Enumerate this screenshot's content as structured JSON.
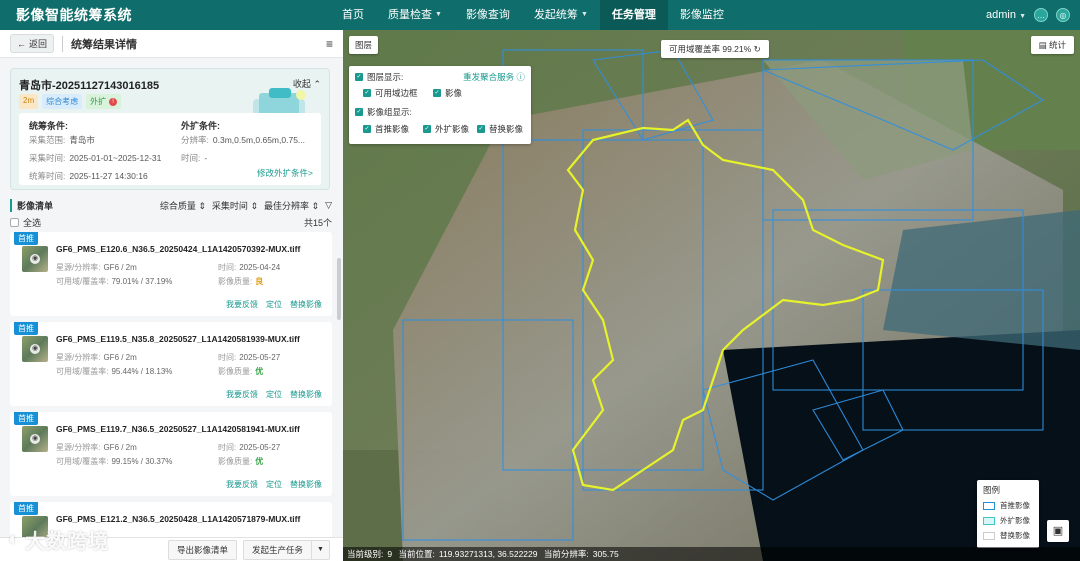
{
  "app": {
    "title": "影像智能统筹系统"
  },
  "nav": [
    {
      "label": "首页",
      "caret": false,
      "active": false
    },
    {
      "label": "质量检查",
      "caret": true,
      "active": false
    },
    {
      "label": "影像查询",
      "caret": false,
      "active": false
    },
    {
      "label": "发起统筹",
      "caret": true,
      "active": false
    },
    {
      "label": "任务管理",
      "caret": false,
      "active": true
    },
    {
      "label": "影像监控",
      "caret": false,
      "active": false
    }
  ],
  "user": {
    "name": "admin"
  },
  "panel": {
    "back_label": "返回",
    "title": "统筹结果详情",
    "task": {
      "name": "青岛市-20251127143016185",
      "collapse_label": "收起",
      "tags": [
        "2m",
        "综合考虑",
        "外扩"
      ],
      "tag_alert": "!",
      "plan_title": "统筹条件:",
      "plan": [
        {
          "k": "采集范围:",
          "v": "青岛市"
        },
        {
          "k": "采集时间:",
          "v": "2025-01-01~2025-12-31"
        },
        {
          "k": "统筹时间:",
          "v": "2025-11-27 14:30:16"
        }
      ],
      "ext_title": "外扩条件:",
      "ext": [
        {
          "k": "分辨率:",
          "v": "0.3m,0.5m,0.65m,0.75..."
        },
        {
          "k": "时间:",
          "v": "-"
        }
      ],
      "modify_link": "修改外扩条件>"
    },
    "list": {
      "title": "影像清单",
      "sorts": [
        "综合质量",
        "采集时间",
        "最佳分辨率"
      ],
      "select_all": "全选",
      "total": "共15个"
    },
    "cards": [
      {
        "badge": "首推",
        "name": "GF6_PMS_E120.6_N36.5_20250424_L1A1420570392-MUX.tiff",
        "source_k": "星源/分辨率:",
        "source": "GF6 / 2m",
        "time_k": "时间:",
        "time": "2025-04-24",
        "cover_k": "可用域/覆盖率:",
        "cover": "79.01% / 37.19%",
        "quality_k": "影像质量:",
        "quality": "良",
        "quality_level": "fair",
        "actions": [
          "我要反馈",
          "定位",
          "替换影像"
        ]
      },
      {
        "badge": "首推",
        "name": "GF6_PMS_E119.5_N35.8_20250527_L1A1420581939-MUX.tiff",
        "source_k": "星源/分辨率:",
        "source": "GF6 / 2m",
        "time_k": "时间:",
        "time": "2025-05-27",
        "cover_k": "可用域/覆盖率:",
        "cover": "95.44% / 18.13%",
        "quality_k": "影像质量:",
        "quality": "优",
        "quality_level": "good",
        "actions": [
          "我要反馈",
          "定位",
          "替换影像"
        ]
      },
      {
        "badge": "首推",
        "name": "GF6_PMS_E119.7_N36.5_20250527_L1A1420581941-MUX.tiff",
        "source_k": "星源/分辨率:",
        "source": "GF6 / 2m",
        "time_k": "时间:",
        "time": "2025-05-27",
        "cover_k": "可用域/覆盖率:",
        "cover": "99.15% / 30.37%",
        "quality_k": "影像质量:",
        "quality": "优",
        "quality_level": "good",
        "actions": [
          "我要反馈",
          "定位",
          "替换影像"
        ]
      },
      {
        "badge": "首推",
        "name": "GF6_PMS_E121.2_N36.5_20250428_L1A1420571879-MUX.tiff"
      }
    ],
    "footer": {
      "export": "导出影像清单",
      "produce": "发起生产任务"
    },
    "watermark": "大数跨境"
  },
  "map": {
    "layer_button": "图层",
    "coverage": "可用域覆盖率 99.21%",
    "stats_button": "统计",
    "layer_panel": {
      "layer_title": "图层显示:",
      "republish": "重发聚合服务",
      "layers": [
        "可用域边框",
        "影像"
      ],
      "group_title": "影像组显示:",
      "groups": [
        "首推影像",
        "外扩影像",
        "替换影像"
      ]
    },
    "legend": {
      "title": "图例",
      "items": [
        {
          "label": "首推影像",
          "color": "#1f8fd6",
          "fill": "#ffffff"
        },
        {
          "label": "外扩影像",
          "color": "#3fc7c4",
          "fill": "#d8f6f5"
        },
        {
          "label": "替换影像",
          "color": "#cccccc",
          "fill": "#ffffff"
        }
      ]
    },
    "status": {
      "level_label": "当前级别:",
      "level": "9",
      "pos_label": "当前位置:",
      "pos": "119.93271313, 36.522229",
      "res_label": "当前分辨率:",
      "res": "305.75"
    }
  }
}
